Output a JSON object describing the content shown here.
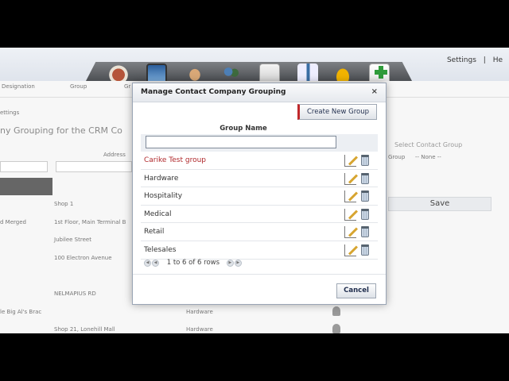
{
  "top_links": [
    "Settings",
    "|",
    "He"
  ],
  "toolbar_icons": [
    "house-icon",
    "monitor-icon",
    "handshake-icon",
    "people-icon",
    "documents-icon",
    "reports-icon",
    "hardhat-icon",
    "add-icon"
  ],
  "background": {
    "columns": [
      "Designation",
      "Group",
      "Gr"
    ],
    "settings": "ettings",
    "heading": "ny Grouping for the CRM Co",
    "address_label": "Address",
    "select_group_placeholder": "Select Contact Group",
    "group_label": "Group",
    "none_option": "-- None --",
    "save_label": "Save",
    "rows": [
      {
        "left": "",
        "addr": "Shop 1",
        "grp": ""
      },
      {
        "left": "d Merged",
        "addr": "1st Floor, Main Terminal B",
        "grp": ""
      },
      {
        "left": "",
        "addr": "Jubilee Street",
        "grp": ""
      },
      {
        "left": "",
        "addr": "100 Electron Avenue",
        "grp": ""
      },
      {
        "left": "",
        "addr": "NELMAPIUS RD",
        "grp": ""
      },
      {
        "left": "le Big Al's Brac",
        "addr": "",
        "grp": "Hardware"
      },
      {
        "left": "",
        "addr": "Shop 21, Lonehill Mall",
        "grp": "Hardware"
      }
    ]
  },
  "modal": {
    "title": "Manage Contact Company Grouping",
    "close": "×",
    "create_button": "Create New Group",
    "column_header": "Group Name",
    "filter_value": "",
    "groups": [
      {
        "name": "Carike Test group",
        "highlight": true
      },
      {
        "name": "Hardware",
        "highlight": false
      },
      {
        "name": "Hospitality",
        "highlight": false
      },
      {
        "name": "Medical",
        "highlight": false
      },
      {
        "name": "Retail",
        "highlight": false
      },
      {
        "name": "Telesales",
        "highlight": false
      }
    ],
    "pager": "1 to 6 of 6 rows",
    "cancel_button": "Cancel"
  },
  "colors": {
    "accent_red": "#c0282b",
    "highlight_text": "#b0292c"
  }
}
